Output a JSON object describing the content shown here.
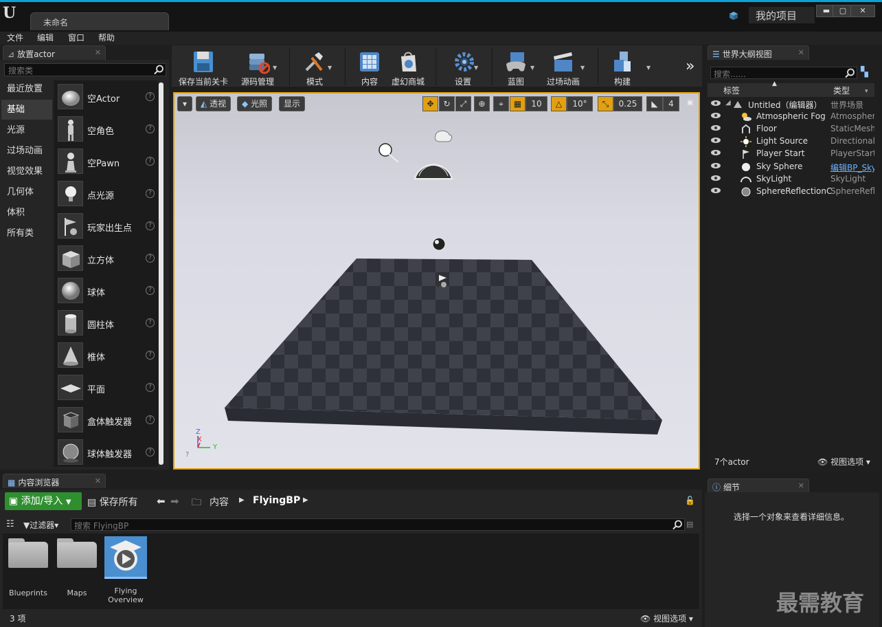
{
  "window": {
    "doc_tab": "未命名",
    "project_name": "我的项目",
    "minimize": "▬",
    "maximize": "▢",
    "close": "✕"
  },
  "menu": [
    "文件",
    "编辑",
    "窗口",
    "帮助"
  ],
  "place_actor": {
    "tab_label": "放置actor",
    "search_placeholder": "搜索类",
    "categories": [
      "最近放置",
      "基础",
      "光源",
      "过场动画",
      "视觉效果",
      "几何体",
      "体积",
      "所有类"
    ],
    "active_category": "基础",
    "items": [
      "空Actor",
      "空角色",
      "空Pawn",
      "点光源",
      "玩家出生点",
      "立方体",
      "球体",
      "圆柱体",
      "椎体",
      "平面",
      "盒体触发器",
      "球体触发器"
    ]
  },
  "toolbar": {
    "items": [
      {
        "label": "保存当前关卡",
        "icon": "floppy-disk-icon"
      },
      {
        "label": "源码管理",
        "icon": "source-control-icon"
      },
      {
        "label": "模式",
        "icon": "modes-tools-icon"
      },
      {
        "label": "内容",
        "icon": "content-grid-icon"
      },
      {
        "label": "虚幻商城",
        "icon": "marketplace-bag-icon"
      },
      {
        "label": "设置",
        "icon": "settings-gear-icon"
      },
      {
        "label": "蓝图",
        "icon": "blueprint-gamepad-icon"
      },
      {
        "label": "过场动画",
        "icon": "clapperboard-icon"
      },
      {
        "label": "构建",
        "icon": "build-cubes-icon"
      }
    ],
    "overflow": "»"
  },
  "viewport": {
    "perspective": "透视",
    "lighting": "光照",
    "show": "显示",
    "grid_snap": "10",
    "rotation_snap": "10°",
    "scale_snap": "0.25",
    "camera_speed": "4",
    "axis_x": "X",
    "axis_y": "Y",
    "axis_z": "Z"
  },
  "outliner": {
    "tab_label": "世界大纲视图",
    "search_placeholder": "搜索......",
    "col_label": "标签",
    "col_type": "类型",
    "rows": [
      {
        "label": "Untitled（编辑器）",
        "type": "世界场景",
        "link": false,
        "icon": "world-icon"
      },
      {
        "label": "Atmospheric Fog",
        "type": "AtmosphericFog",
        "link": false,
        "icon": "fog-icon"
      },
      {
        "label": "Floor",
        "type": "StaticMeshActor",
        "link": false,
        "icon": "mesh-icon"
      },
      {
        "label": "Light Source",
        "type": "DirectionalLight",
        "link": false,
        "icon": "sun-icon"
      },
      {
        "label": "Player Start",
        "type": "PlayerStart",
        "link": false,
        "icon": "flag-icon"
      },
      {
        "label": "Sky Sphere",
        "type": "编辑BP_Sky_Sphere",
        "link": true,
        "icon": "sphere-icon"
      },
      {
        "label": "SkyLight",
        "type": "SkyLight",
        "link": false,
        "icon": "skylight-icon"
      },
      {
        "label": "SphereReflectionCapture",
        "type": "SphereReflectionCapture",
        "link": false,
        "icon": "reflection-icon"
      }
    ],
    "count": "7个actor",
    "view_options": "视图选项"
  },
  "details": {
    "tab_label": "细节",
    "empty_message": "选择一个对象来查看详细信息。"
  },
  "content_browser": {
    "tab_label": "内容浏览器",
    "add_import": "添加/导入",
    "save_all": "保存所有",
    "path": [
      "内容",
      "FlyingBP"
    ],
    "filters": "过滤器",
    "search_placeholder": "搜索 FlyingBP",
    "assets": [
      {
        "label": "Blueprints",
        "kind": "folder"
      },
      {
        "label": "Maps",
        "kind": "folder"
      },
      {
        "label": "Flying Overview",
        "kind": "level"
      }
    ],
    "item_count": "3 项",
    "view_options": "视图选项"
  },
  "watermark": "最需教育",
  "colors": {
    "accent_blue": "#0aa2d6",
    "viewport_border": "#e2a010",
    "add_button": "#2f8f2f",
    "link_blue": "#6ab2ff"
  }
}
